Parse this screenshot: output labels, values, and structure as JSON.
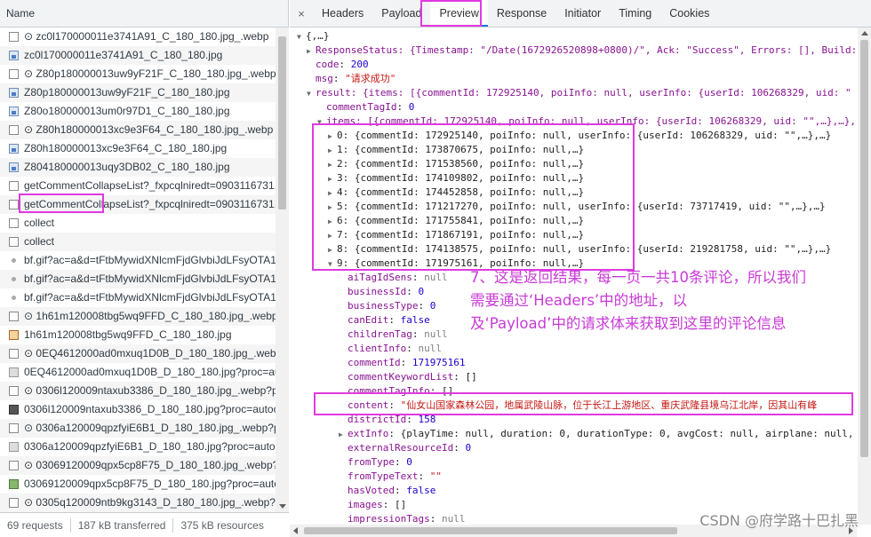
{
  "left_panel": {
    "header": "Name",
    "requests": [
      {
        "icon": "doc-icon",
        "name": "⊙ zc0l170000011e3741A91_C_180_180.jpg_.webp"
      },
      {
        "icon": "image-icon",
        "name": "zc0l170000011e3741A91_C_180_180.jpg"
      },
      {
        "icon": "doc-icon",
        "name": "⊙ Z80p180000013uw9yF21F_C_180_180.jpg_.webp"
      },
      {
        "icon": "image-icon",
        "name": "Z80p180000013uw9yF21F_C_180_180.jpg"
      },
      {
        "icon": "image-icon",
        "name": "Z80o180000013um0r97D1_C_180_180.jpg"
      },
      {
        "icon": "doc-icon",
        "name": "⊙ Z80h180000013xc9e3F64_C_180_180.jpg_.webp"
      },
      {
        "icon": "image-icon",
        "name": "Z80h180000013xc9e3F64_C_180_180.jpg"
      },
      {
        "icon": "image-icon",
        "name": "Z804180000013uqy3DB02_C_180_180.jpg"
      },
      {
        "icon": "fetch-icon",
        "name": "getCommentCollapseList?_fxpcqlniredt=0903116731..."
      },
      {
        "icon": "doc-icon",
        "name": "getCommentCollapseList?_fxpcqlniredt=0903116731..."
      },
      {
        "icon": "doc-icon",
        "name": "collect"
      },
      {
        "icon": "doc-icon",
        "name": "collect"
      },
      {
        "icon": "dot-icon",
        "name": "bf.gif?ac=a&d=tFtbMywidXNlcmFjdGlvbiJdLFsyOTA1"
      },
      {
        "icon": "dot-icon",
        "name": "bf.gif?ac=a&d=tFtbMywidXNlcmFjdGlvbiJdLFsyOTA1"
      },
      {
        "icon": "dot-icon",
        "name": "bf.gif?ac=a&d=tFtbMywidXNlcmFjdGlvbiJdLFsyOTA1"
      },
      {
        "icon": "doc-icon",
        "name": "⊙ 1h61m120008tbg5wq9FFD_C_180_180.jpg_.webp"
      },
      {
        "icon": "brown-image-icon",
        "name": "1h61m120008tbg5wq9FFD_C_180_180.jpg"
      },
      {
        "icon": "doc-icon",
        "name": "⊙ 0EQ4612000ad0mxuq1D0B_D_180_180.jpg_.webp?"
      },
      {
        "icon": "gray-image-icon",
        "name": "0EQ4612000ad0mxuq1D0B_D_180_180.jpg?proc=aut"
      },
      {
        "icon": "doc-icon",
        "name": "⊙ 0306l120009ntaxub3386_D_180_180.jpg_.webp?pr"
      },
      {
        "icon": "dark-image-icon",
        "name": "0306l120009ntaxub3386_D_180_180.jpg?proc=autoo"
      },
      {
        "icon": "doc-icon",
        "name": "⊙ 0306a120009qpzfyiE6B1_D_180_180.jpg_.webp?pr"
      },
      {
        "icon": "gray-image-icon",
        "name": "0306a120009qpzfyiE6B1_D_180_180.jpg?proc=autoo"
      },
      {
        "icon": "doc-icon",
        "name": "⊙ 03069120009qpx5cp8F75_D_180_180.jpg_.webp?p"
      },
      {
        "icon": "green-image-icon",
        "name": "03069120009qpx5cp8F75_D_180_180.jpg?proc=auto."
      },
      {
        "icon": "doc-icon",
        "name": "⊙ 0305q120009ntb9kg3143_D_180_180.jpg_.webp?p"
      }
    ],
    "status": {
      "requests": "69 requests",
      "transferred": "187 kB transferred",
      "resources": "375 kB resources"
    }
  },
  "tabs": {
    "close": "×",
    "items": [
      "Headers",
      "Payload",
      "Preview",
      "Response",
      "Initiator",
      "Timing",
      "Cookies"
    ],
    "active": "Preview"
  },
  "preview": {
    "root": "{,…}",
    "response_status": "ResponseStatus: {Timestamp: \"/Date(1672926520898+0800)/\", Ack: \"Success\", Errors: [], Build:",
    "code_key": "code",
    "code_val": "200",
    "msg_key": "msg",
    "msg_val": "\"请求成功\"",
    "result_line": "result: {items: [{commentId: 172925140, poiInfo: null, userInfo: {userId: 106268329, uid: \"",
    "comment_tag_key": "commentTagId",
    "comment_tag_val": "0",
    "items_line": "items: [{commentId: 172925140, poiInfo: null, userInfo: {userId: 106268329, uid: \"\",…},…},",
    "items": [
      "0: {commentId: 172925140, poiInfo: null, userInfo: {userId: 106268329, uid: \"\",…},…}",
      "1: {commentId: 173870675, poiInfo: null,…}",
      "2: {commentId: 171538560, poiInfo: null,…}",
      "3: {commentId: 174109802, poiInfo: null,…}",
      "4: {commentId: 174452858, poiInfo: null,…}",
      "5: {commentId: 171217270, poiInfo: null, userInfo: {userId: 73717419, uid: \"\",…},…}",
      "6: {commentId: 171755841, poiInfo: null,…}",
      "7: {commentId: 171867191, poiInfo: null,…}",
      "8: {commentId: 174138575, poiInfo: null, userInfo: {userId: 219281758, uid: \"\",…},…}",
      "9: {commentId: 171975161, poiInfo: null,…}"
    ],
    "fields": [
      {
        "key": "aiTagIdSens",
        "val": "null",
        "type": "nl"
      },
      {
        "key": "businessId",
        "val": "0",
        "type": "n"
      },
      {
        "key": "businessType",
        "val": "0",
        "type": "n"
      },
      {
        "key": "canEdit",
        "val": "false",
        "type": "n"
      },
      {
        "key": "childrenTag",
        "val": "null",
        "type": "nl"
      },
      {
        "key": "clientInfo",
        "val": "null",
        "type": "nl"
      },
      {
        "key": "commentId",
        "val": "171975161",
        "type": "n"
      },
      {
        "key": "commentKeywordList",
        "val": "[]",
        "type": "p"
      },
      {
        "key": "commentTagInfo",
        "val": "[]",
        "type": "p"
      },
      {
        "key": "content",
        "val": "\"仙女山国家森林公园，地属武陵山脉，位于长江上游地区、重庆武隆县境乌江北岸，因其山有峰",
        "type": "s"
      },
      {
        "key": "districtId",
        "val": "158",
        "type": "n"
      },
      {
        "key": "extInfo",
        "val": "{playTime: null, duration: 0, durationType: 0, avgCost: null, airplane: null,",
        "type": "p",
        "expandable": true
      },
      {
        "key": "externalResourceId",
        "val": "0",
        "type": "n"
      },
      {
        "key": "fromType",
        "val": "0",
        "type": "n"
      },
      {
        "key": "fromTypeText",
        "val": "\"\"",
        "type": "s"
      },
      {
        "key": "hasVoted",
        "val": "false",
        "type": "n"
      },
      {
        "key": "images",
        "val": "[]",
        "type": "p"
      },
      {
        "key": "impressionTags",
        "val": "null",
        "type": "nl"
      }
    ]
  },
  "annotation": {
    "line1": "7、这是返回结果，每一页一共10条评论，所以我们",
    "line2": "需要通过‘Headers’中的地址，以",
    "line3": "及‘Payload’中的请求体来获取到这里的评论信息"
  },
  "watermark": "CSDN @府学路十巴扎黑",
  "colors": {
    "highlight": "#e03ae0",
    "annotation": "#c83ad6",
    "active_tab": "#1a73e8"
  }
}
